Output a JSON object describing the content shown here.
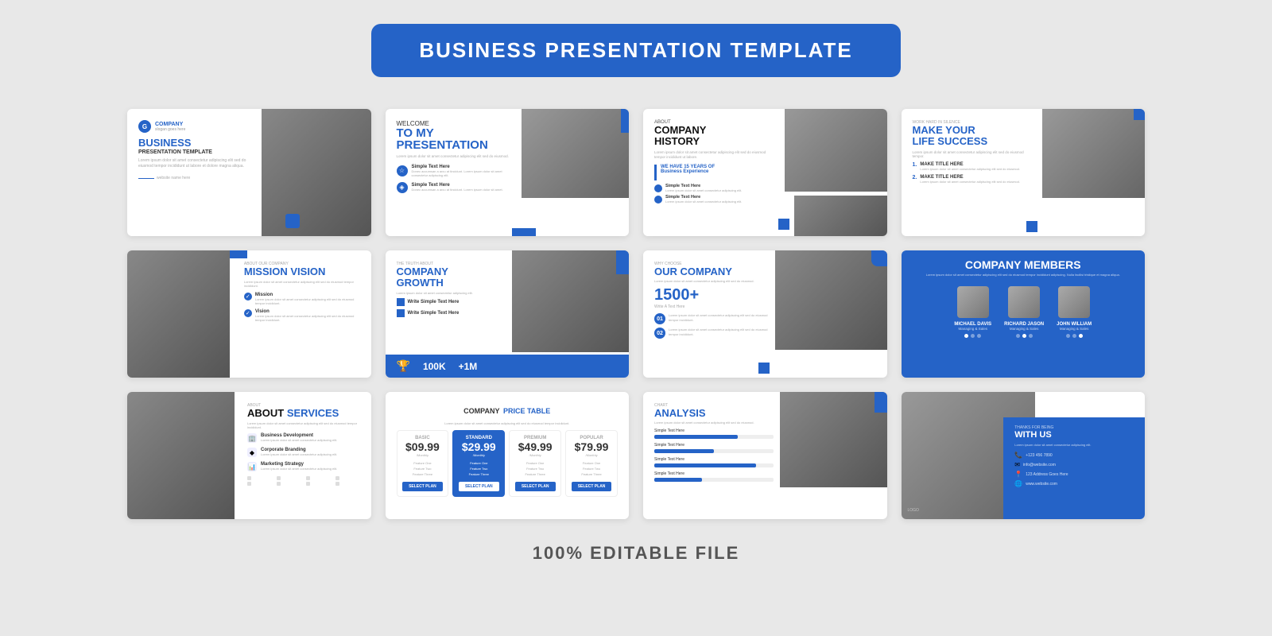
{
  "header": {
    "title": "BUSINESS PRESENTATION TEMPLATE"
  },
  "slides": {
    "slide1": {
      "logo": "COMPANY",
      "logo_slogan": "slogan goes here",
      "heading": "BUSINESS",
      "subheading": "PRESENTATION TEMPLATE",
      "body": "Lorem ipsum dolor sit amet consectetur adipiscing elit sed do eiusmod tempor incididunt ut labore et dolore magna aliqua.",
      "footer": "website name here"
    },
    "slide2": {
      "tag": "WELCOME",
      "title": "TO MY\nPRESENTATION",
      "body": "Lorem ipsum dolor sit amet consectetur adipiscing elit sed do eiusmod.",
      "item1_title": "Simple Text Here",
      "item1_sub": "Donec accumsan a arcu at tincidunt. Lorem ipsum dolor sit amet consectetur adipiscing elit.",
      "item2_title": "Simple Text Here",
      "item2_sub": "Donec accumsan a arcu at tincidunt. Lorem ipsum dolor sit amet."
    },
    "slide3": {
      "tag": "ABOUT",
      "title": "COMPANY\nHISTORY",
      "body": "Lorem ipsum dolor sit amet consectetur adipiscing elit sed do eiusmod tempor incididunt ut labore.",
      "rule_title": "WE HAVE 15 YEARS OF\nBusiness Experience",
      "rule_sub1_title": "Simple Text Here",
      "rule_sub1": "Lorem ipsum dolor sit amet consectetur adipiscing elit.",
      "rule_sub2_title": "Simple Text Here",
      "rule_sub2": "Lorem ipsum dolor sit amet consectetur adipiscing elit."
    },
    "slide4": {
      "tag": "WORK HARD IN SILENCE",
      "title": "MAKE YOUR\nLIFE SUCCESS",
      "body": "Lorem ipsum dolor sit amet consectetur adipiscing elit sed do eiusmod tempor.",
      "item1_num": "1.",
      "item1_title": "MAKE TITLE HERE",
      "item1_sub": "Lorem ipsum dolor sit amet consectetur adipiscing elit sed do eiusmod.",
      "item2_num": "2.",
      "item2_title": "MAKE TITLE HERE",
      "item2_sub": "Lorem ipsum dolor sit amet consectetur adipiscing elit sed do eiusmod."
    },
    "slide5": {
      "tag": "ABOUT OUR COMPANY",
      "title": "MISSION VISION",
      "body": "Lorem ipsum dolor sit amet consectetur adipiscing elit sed do eiusmod tempor incididunt.",
      "section1_title": "Mission",
      "section1_sub": "Lorem ipsum dolor sit amet consectetur adipiscing elit sed do eiusmod tempor incididunt.",
      "section2_title": "Vision",
      "section2_sub": "Lorem ipsum dolor sit amet consectetur adipiscing elit sed do eiusmod tempor incididunt."
    },
    "slide6": {
      "tag": "THE TRUTH ABOUT",
      "title": "COMPANY\nGROWTH",
      "body": "Lorem ipsum dolor sit amet consectetur adipiscing elit.",
      "item1": "Write Simple Text Here",
      "item2": "Write Simple Text Here",
      "stat1": "100K",
      "stat2": "+1M"
    },
    "slide7": {
      "tag": "WHY CHOOSE",
      "title": "OUR COMPANY",
      "body": "Lorem ipsum dolor sit amet consectetur adipiscing elit sed do eiusmod.",
      "stat": "1500+",
      "stat_sub": "Write A Text Here",
      "item1": "Lorem ipsum dolor sit amet consectetur adipiscing elit sed do eiusmod tempor incididunt.",
      "item2": "Lorem ipsum dolor sit amet consectetur adipiscing elit sed do eiusmod tempor incididunt."
    },
    "slide8": {
      "title": "COMPANY MEMBERS",
      "body": "Lorem ipsum dolor sit amet consectetur adipiscing elit sed do eiusmod tempor incididunt adipiscing. Nulla facilisi tristique et magna aliqua.",
      "member1_name": "MICHAEL DAVIS",
      "member1_role": "Managing & Sales",
      "member2_name": "RICHARD JASON",
      "member2_role": "Managing & Sales",
      "member3_name": "JOHN WILLIAM",
      "member3_role": "Managing & Sales"
    },
    "slide9": {
      "tag": "ABOUT",
      "title": "SERVICES",
      "title_blue": "SERVICES",
      "body": "Lorem ipsum dolor sit amet consectetur adipiscing elit sed do eiusmod tempor incididunt.",
      "service1_title": "Business Development",
      "service1_sub": "Lorem ipsum dolor sit amet consectetur adipiscing elit.",
      "service2_title": "Corporate Branding",
      "service2_sub": "Lorem ipsum dolor sit amet consectetur adipiscing elit.",
      "service3_title": "Marketing Strategy",
      "service3_sub": "Lorem ipsum dolor sit amet consectetur adipiscing elit."
    },
    "slide10": {
      "title_part1": "COMPANY",
      "title_part2": "PRICE TABLE",
      "body": "Lorem ipsum dolor sit amet consectetur adipiscing elit sed do eiusmod tempor incididunt.",
      "plan1_name": "BASIC",
      "plan1_price": "$09.99",
      "plan1_period": "/Monthly",
      "plan1_features": "Feature One\nFeature Two\nFeature Three",
      "plan1_btn": "SELECT PLAN",
      "plan2_name": "STANDARD",
      "plan2_price": "$29.99",
      "plan2_period": "/Monthly",
      "plan2_features": "Feature One\nFeature Two\nFeature Three",
      "plan2_btn": "SELECT PLAN",
      "plan3_name": "PREMIUM",
      "plan3_price": "$49.99",
      "plan3_period": "/Monthly",
      "plan3_features": "Feature One\nFeature Two\nFeature Three",
      "plan3_btn": "SELECT PLAN",
      "plan4_name": "POPULAR",
      "plan4_price": "$79.99",
      "plan4_period": "/Monthly",
      "plan4_features": "Feature One\nFeature Two\nFeature Three",
      "plan4_btn": "SELECT PLAN"
    },
    "slide11": {
      "tag": "CHART",
      "title": "ANALYSIS",
      "body": "Lorem ipsum dolor sit amet consectetur adipiscing elit sed do eiusmod.",
      "bar1_label": "Simple Text Here",
      "bar1_pct": "70",
      "bar2_label": "Simple Text Here",
      "bar2_pct": "50",
      "bar3_label": "Simple Text Here",
      "bar3_pct": "85",
      "bar4_label": "Simple Text Here",
      "bar4_pct": "40"
    },
    "slide12": {
      "tag": "THANKS FOR BEING",
      "title": "WITH US",
      "body": "Lorem ipsum dolor sit amet consectetur adipiscing elit.",
      "contact1": "+123 456 7890",
      "contact2": "info@website.com",
      "contact3": "123 Address Goes Here",
      "contact4": "www.website.com",
      "logo": "LOGO"
    }
  },
  "footer": {
    "label": "100% EDITABLE FILE"
  },
  "colors": {
    "blue": "#2563c7",
    "dark": "#111111",
    "gray": "#aaaaaa",
    "light_bg": "#e8e8e8"
  }
}
